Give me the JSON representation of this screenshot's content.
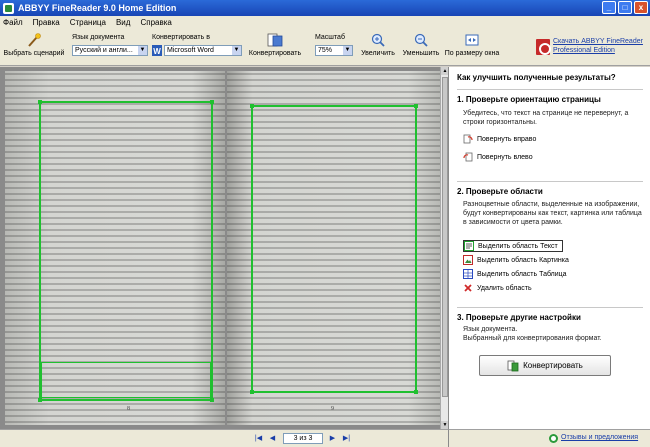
{
  "window": {
    "title": "ABBYY FineReader 9.0 Home Edition",
    "minimize": "_",
    "maximize": "□",
    "close": "x"
  },
  "menu": [
    "Файл",
    "Правка",
    "Страница",
    "Вид",
    "Справка"
  ],
  "toolbar": {
    "scenario_label": "Выбрать сценарий",
    "language_label": "Язык документа",
    "language_value": "Русский и англи...",
    "convert_to_label": "Конвертировать в",
    "convert_to_value": "Microsoft Word",
    "convert_label": "Конвертировать",
    "zoom_label": "Масштаб",
    "zoom_value": "75%",
    "zoom_in_label": "Увеличить",
    "zoom_out_label": "Уменьшить",
    "fit_width_label": "По размеру окна",
    "promo_line1": "Скачать ABBYY FineReader",
    "promo_line2": "Professional Edition"
  },
  "pages": {
    "left_number": "8",
    "right_number": "9"
  },
  "navigation": {
    "first": "|◀",
    "prev": "◀",
    "page_counter": "3 из 3",
    "next": "▶",
    "last": "▶|"
  },
  "panel": {
    "title": "Как улучшить полученные результаты?",
    "section1": {
      "title": "1. Проверьте ориентацию страницы",
      "text": "Убедитесь, что текст на странице не перевернут, а строки горизонтальны.",
      "rotate_right": "Повернуть вправо",
      "rotate_left": "Повернуть влево"
    },
    "section2": {
      "title": "2. Проверьте области",
      "text": "Разноцветные области, выделенные на изображении, будут конвертированы как текст, картинка или таблица в зависимости от цвета рамки.",
      "select_text": "Выделить область Текст",
      "select_picture": "Выделить область Картинка",
      "select_table": "Выделить область Таблица",
      "delete_area": "Удалить область"
    },
    "section3": {
      "title": "3. Проверьте другие настройки",
      "line1": "Язык документа.",
      "line2": "Выбранный для конвертирования формат."
    },
    "convert_button": "Конвертировать"
  },
  "status": {
    "link": "Отзывы и предложения"
  }
}
